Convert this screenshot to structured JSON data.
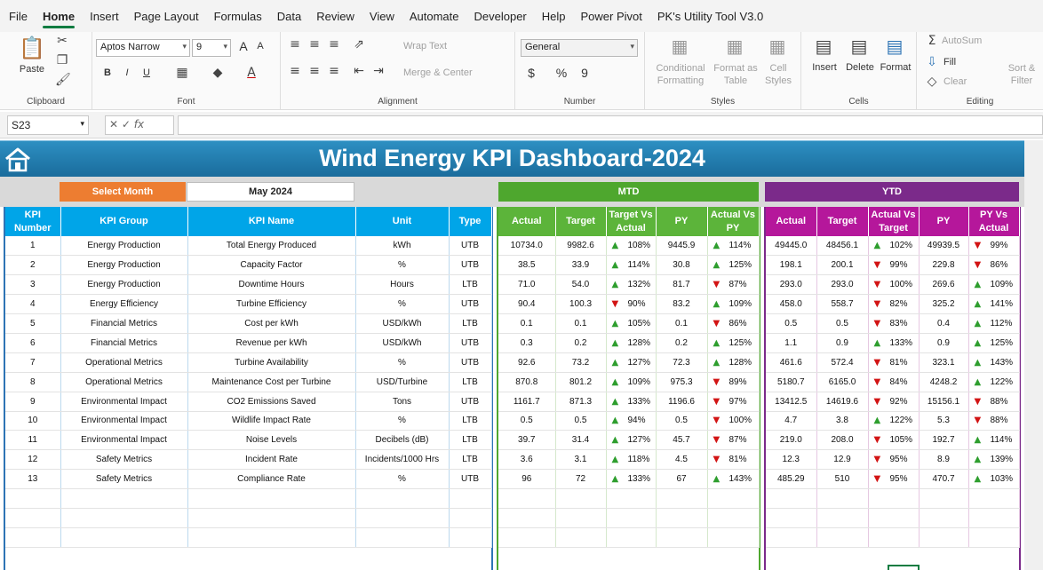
{
  "menu": [
    "File",
    "Home",
    "Insert",
    "Page Layout",
    "Formulas",
    "Data",
    "Review",
    "View",
    "Automate",
    "Developer",
    "Help",
    "Power Pivot",
    "PK's Utility Tool V3.0"
  ],
  "menu_active": "Home",
  "ribbon": {
    "clipboard": {
      "label": "Clipboard",
      "paste": "Paste"
    },
    "font": {
      "label": "Font",
      "font_name": "Aptos Narrow",
      "font_size": "9",
      "bold": "B",
      "italic": "I",
      "underline": "U",
      "grow": "A",
      "shrink": "A"
    },
    "alignment": {
      "label": "Alignment",
      "wrap": "Wrap Text",
      "merge": "Merge & Center"
    },
    "number": {
      "label": "Number",
      "format": "General",
      "currency": "$",
      "percent": "%",
      "comma": "9"
    },
    "styles": {
      "label": "Styles",
      "conditional": "Conditional Formatting",
      "format_table": "Format as Table",
      "cell_styles": "Cell Styles"
    },
    "cells": {
      "label": "Cells",
      "insert": "Insert",
      "delete": "Delete",
      "format": "Format"
    },
    "editing": {
      "label": "Editing",
      "autosum": "AutoSum",
      "fill": "Fill",
      "clear": "Clear",
      "sort": "Sort & Filter"
    }
  },
  "formula_bar": {
    "name_box": "S23",
    "fx": "fx",
    "formula": ""
  },
  "dashboard": {
    "title": "Wind Energy KPI Dashboard-2024",
    "select_month_label": "Select Month",
    "selected_month": "May 2024",
    "mtd_label": "MTD",
    "ytd_label": "YTD",
    "colors": {
      "banner": "#1a6c9c",
      "main_header": "#00a5e8",
      "mtd_header": "#5cb43a",
      "ytd_header": "#b5179b",
      "select": "#ed7d31",
      "up": "#2e9e2e",
      "down": "#d21414"
    },
    "main_headers": [
      "KPI Number",
      "KPI Group",
      "KPI Name",
      "Unit",
      "Type"
    ],
    "mtd_headers": [
      "Actual",
      "Target",
      "Target Vs Actual",
      "PY",
      "Actual Vs PY"
    ],
    "ytd_headers": [
      "Actual",
      "Target",
      "Actual Vs Target",
      "PY",
      "PY Vs Actual"
    ],
    "rows": [
      {
        "num": "1",
        "group": "Energy Production",
        "name": "Total Energy Produced",
        "unit": "kWh",
        "type": "UTB",
        "m_actual": "10734.0",
        "m_target": "9982.6",
        "m_tva": "108%",
        "m_tva_dir": "up",
        "m_py": "9445.9",
        "m_avp": "114%",
        "m_avp_dir": "up",
        "y_actual": "49445.0",
        "y_target": "48456.1",
        "y_avt": "102%",
        "y_avt_dir": "up",
        "y_py": "49939.5",
        "y_pva": "99%",
        "y_pva_dir": "down"
      },
      {
        "num": "2",
        "group": "Energy Production",
        "name": "Capacity Factor",
        "unit": "%",
        "type": "UTB",
        "m_actual": "38.5",
        "m_target": "33.9",
        "m_tva": "114%",
        "m_tva_dir": "up",
        "m_py": "30.8",
        "m_avp": "125%",
        "m_avp_dir": "up",
        "y_actual": "198.1",
        "y_target": "200.1",
        "y_avt": "99%",
        "y_avt_dir": "down",
        "y_py": "229.8",
        "y_pva": "86%",
        "y_pva_dir": "down"
      },
      {
        "num": "3",
        "group": "Energy Production",
        "name": "Downtime Hours",
        "unit": "Hours",
        "type": "LTB",
        "m_actual": "71.0",
        "m_target": "54.0",
        "m_tva": "132%",
        "m_tva_dir": "up",
        "m_py": "81.7",
        "m_avp": "87%",
        "m_avp_dir": "down",
        "y_actual": "293.0",
        "y_target": "293.0",
        "y_avt": "100%",
        "y_avt_dir": "down",
        "y_py": "269.6",
        "y_pva": "109%",
        "y_pva_dir": "up"
      },
      {
        "num": "4",
        "group": "Energy Efficiency",
        "name": "Turbine Efficiency",
        "unit": "%",
        "type": "UTB",
        "m_actual": "90.4",
        "m_target": "100.3",
        "m_tva": "90%",
        "m_tva_dir": "down",
        "m_py": "83.2",
        "m_avp": "109%",
        "m_avp_dir": "up",
        "y_actual": "458.0",
        "y_target": "558.7",
        "y_avt": "82%",
        "y_avt_dir": "down",
        "y_py": "325.2",
        "y_pva": "141%",
        "y_pva_dir": "up"
      },
      {
        "num": "5",
        "group": "Financial Metrics",
        "name": "Cost per kWh",
        "unit": "USD/kWh",
        "type": "LTB",
        "m_actual": "0.1",
        "m_target": "0.1",
        "m_tva": "105%",
        "m_tva_dir": "up",
        "m_py": "0.1",
        "m_avp": "86%",
        "m_avp_dir": "down",
        "y_actual": "0.5",
        "y_target": "0.5",
        "y_avt": "83%",
        "y_avt_dir": "down",
        "y_py": "0.4",
        "y_pva": "112%",
        "y_pva_dir": "up"
      },
      {
        "num": "6",
        "group": "Financial Metrics",
        "name": "Revenue per kWh",
        "unit": "USD/kWh",
        "type": "UTB",
        "m_actual": "0.3",
        "m_target": "0.2",
        "m_tva": "128%",
        "m_tva_dir": "up",
        "m_py": "0.2",
        "m_avp": "125%",
        "m_avp_dir": "up",
        "y_actual": "1.1",
        "y_target": "0.9",
        "y_avt": "133%",
        "y_avt_dir": "up",
        "y_py": "0.9",
        "y_pva": "125%",
        "y_pva_dir": "up"
      },
      {
        "num": "7",
        "group": "Operational Metrics",
        "name": "Turbine Availability",
        "unit": "%",
        "type": "UTB",
        "m_actual": "92.6",
        "m_target": "73.2",
        "m_tva": "127%",
        "m_tva_dir": "up",
        "m_py": "72.3",
        "m_avp": "128%",
        "m_avp_dir": "up",
        "y_actual": "461.6",
        "y_target": "572.4",
        "y_avt": "81%",
        "y_avt_dir": "down",
        "y_py": "323.1",
        "y_pva": "143%",
        "y_pva_dir": "up"
      },
      {
        "num": "8",
        "group": "Operational Metrics",
        "name": "Maintenance Cost per Turbine",
        "unit": "USD/Turbine",
        "type": "LTB",
        "m_actual": "870.8",
        "m_target": "801.2",
        "m_tva": "109%",
        "m_tva_dir": "up",
        "m_py": "975.3",
        "m_avp": "89%",
        "m_avp_dir": "down",
        "y_actual": "5180.7",
        "y_target": "6165.0",
        "y_avt": "84%",
        "y_avt_dir": "down",
        "y_py": "4248.2",
        "y_pva": "122%",
        "y_pva_dir": "up"
      },
      {
        "num": "9",
        "group": "Environmental Impact",
        "name": "CO2 Emissions Saved",
        "unit": "Tons",
        "type": "UTB",
        "m_actual": "1161.7",
        "m_target": "871.3",
        "m_tva": "133%",
        "m_tva_dir": "up",
        "m_py": "1196.6",
        "m_avp": "97%",
        "m_avp_dir": "down",
        "y_actual": "13412.5",
        "y_target": "14619.6",
        "y_avt": "92%",
        "y_avt_dir": "down",
        "y_py": "15156.1",
        "y_pva": "88%",
        "y_pva_dir": "down"
      },
      {
        "num": "10",
        "group": "Environmental Impact",
        "name": "Wildlife Impact Rate",
        "unit": "%",
        "type": "LTB",
        "m_actual": "0.5",
        "m_target": "0.5",
        "m_tva": "94%",
        "m_tva_dir": "up",
        "m_py": "0.5",
        "m_avp": "100%",
        "m_avp_dir": "down",
        "y_actual": "4.7",
        "y_target": "3.8",
        "y_avt": "122%",
        "y_avt_dir": "up",
        "y_py": "5.3",
        "y_pva": "88%",
        "y_pva_dir": "down"
      },
      {
        "num": "11",
        "group": "Environmental Impact",
        "name": "Noise Levels",
        "unit": "Decibels (dB)",
        "type": "LTB",
        "m_actual": "39.7",
        "m_target": "31.4",
        "m_tva": "127%",
        "m_tva_dir": "up",
        "m_py": "45.7",
        "m_avp": "87%",
        "m_avp_dir": "down",
        "y_actual": "219.0",
        "y_target": "208.0",
        "y_avt": "105%",
        "y_avt_dir": "down",
        "y_py": "192.7",
        "y_pva": "114%",
        "y_pva_dir": "up"
      },
      {
        "num": "12",
        "group": "Safety Metrics",
        "name": "Incident Rate",
        "unit": "Incidents/1000 Hrs",
        "type": "LTB",
        "m_actual": "3.6",
        "m_target": "3.1",
        "m_tva": "118%",
        "m_tva_dir": "up",
        "m_py": "4.5",
        "m_avp": "81%",
        "m_avp_dir": "down",
        "y_actual": "12.3",
        "y_target": "12.9",
        "y_avt": "95%",
        "y_avt_dir": "down",
        "y_py": "8.9",
        "y_pva": "139%",
        "y_pva_dir": "up"
      },
      {
        "num": "13",
        "group": "Safety Metrics",
        "name": "Compliance Rate",
        "unit": "%",
        "type": "UTB",
        "m_actual": "96",
        "m_target": "72",
        "m_tva": "133%",
        "m_tva_dir": "up",
        "m_py": "67",
        "m_avp": "143%",
        "m_avp_dir": "up",
        "y_actual": "485.29",
        "y_target": "510",
        "y_avt": "95%",
        "y_avt_dir": "down",
        "y_py": "470.7",
        "y_pva": "103%",
        "y_pva_dir": "up"
      }
    ]
  }
}
